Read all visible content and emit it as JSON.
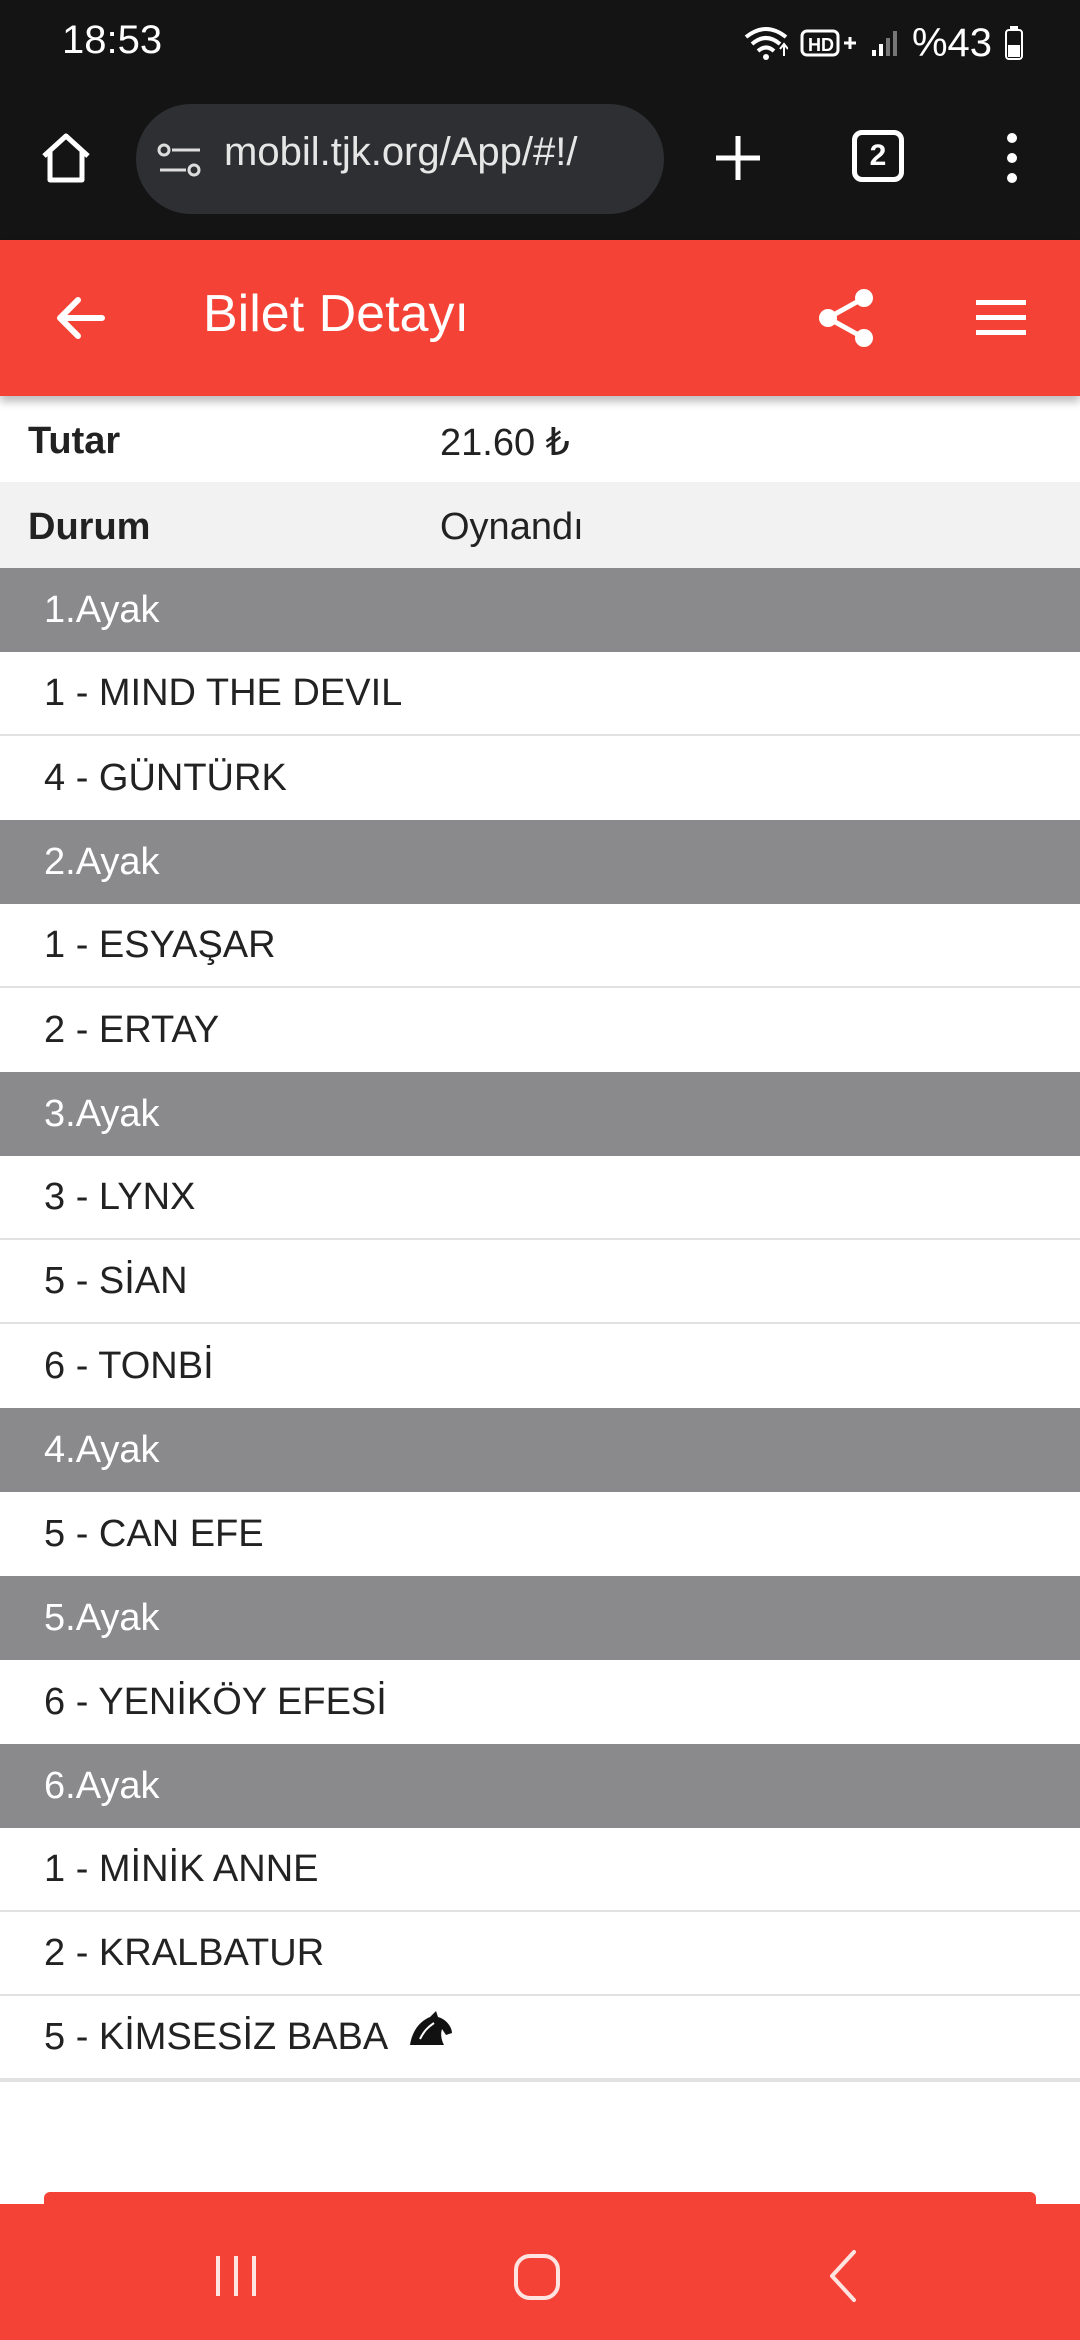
{
  "status_bar": {
    "time": "18:53",
    "battery_text": "%43",
    "icons": [
      "wifi-icon",
      "hd-plus-icon",
      "signal-icon",
      "battery-icon"
    ]
  },
  "browser": {
    "url": "mobil.tjk.org/App/#!/",
    "tab_count": "2",
    "icons": [
      "home-icon",
      "tune-icon",
      "plus-icon",
      "more-vertical-icon"
    ]
  },
  "header": {
    "title": "Bilet Detayı",
    "icons": [
      "arrow-back-icon",
      "share-icon",
      "hamburger-menu-icon"
    ]
  },
  "info": [
    {
      "label": "Tutar",
      "value": "21.60 ₺"
    },
    {
      "label": "Durum",
      "value": "Oynandı"
    }
  ],
  "legs": [
    {
      "title": "1.Ayak",
      "horses": [
        "1 - MIND THE DEVIL",
        "4 - GÜNTÜRK"
      ]
    },
    {
      "title": "2.Ayak",
      "horses": [
        "1 - ESYAŞAR",
        "2 - ERTAY"
      ]
    },
    {
      "title": "3.Ayak",
      "horses": [
        "3 - LYNX",
        "5 - SİAN",
        "6 - TONBİ"
      ]
    },
    {
      "title": "4.Ayak",
      "horses": [
        "5 - CAN EFE"
      ]
    },
    {
      "title": "5.Ayak",
      "horses": [
        "6 - YENİKÖY EFESİ"
      ]
    },
    {
      "title": "6.Ayak",
      "horses": [
        "1 - MİNİK ANNE",
        "2 - KRALBATUR",
        "5 - KİMSESİZ BABA"
      ]
    }
  ],
  "horse_icon_row": "5 - KİMSESİZ BABA",
  "colors": {
    "brand_red": "#f44336",
    "leg_header_gray": "#8a8a8c",
    "chrome_dark": "#141414"
  }
}
